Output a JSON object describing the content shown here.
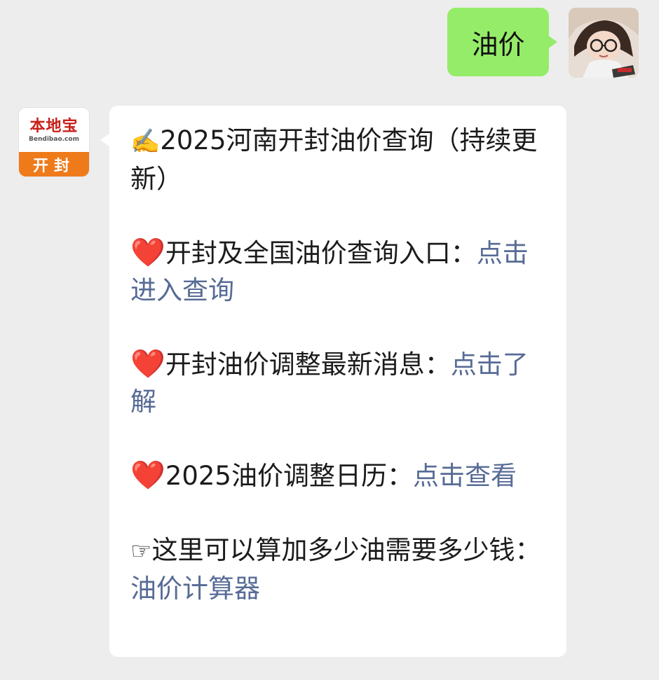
{
  "sent_message": {
    "text": "油价"
  },
  "received_message": {
    "avatar": {
      "brand_name": "本地宝",
      "brand_url": "Bendibao.com",
      "city": "开封"
    },
    "title": {
      "icon": "✍️",
      "text": "2025河南开封油价查询（持续更新）"
    },
    "items": [
      {
        "icon": "❤️",
        "label": "开封及全国油价查询入口：",
        "link": "点击进入查询"
      },
      {
        "icon": "❤️",
        "label": "开封油价调整最新消息：",
        "link": "点击了解"
      },
      {
        "icon": "❤️",
        "label": "2025油价调整日历：",
        "link": "点击查看"
      }
    ],
    "footer": {
      "icon": "☞",
      "label": "这里可以算加多少油需要多少钱：",
      "link": "油价计算器"
    }
  },
  "colors": {
    "background": "#ededed",
    "sent_bubble": "#95ec69",
    "received_bubble": "#ffffff",
    "link": "#576b95",
    "brand_orange": "#ee7a1a",
    "brand_red": "#c8201b"
  }
}
